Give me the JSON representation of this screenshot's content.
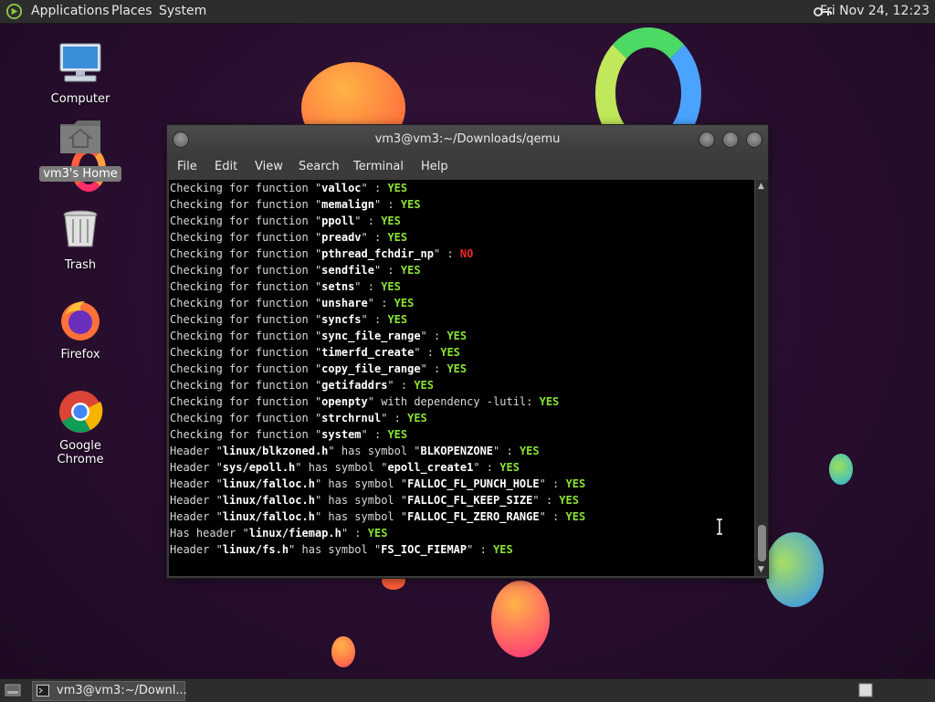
{
  "top_panel": {
    "menus": [
      "Applications",
      "Places",
      "System"
    ],
    "clock": "Fri Nov 24, 12:23"
  },
  "desktop_icons": [
    {
      "label": "Computer",
      "icon": "computer-icon"
    },
    {
      "label": "vm3's Home",
      "icon": "home-folder-icon",
      "selected": true
    },
    {
      "label": "Trash",
      "icon": "trash-icon"
    },
    {
      "label": "Firefox",
      "icon": "firefox-icon"
    },
    {
      "label": "Google Chrome",
      "icon": "chrome-icon"
    }
  ],
  "window": {
    "title": "vm3@vm3:~/Downloads/qemu",
    "menus": [
      "File",
      "Edit",
      "View",
      "Search",
      "Terminal",
      "Help"
    ]
  },
  "terminal": {
    "lines": [
      [
        [
          "Checking for function \"",
          "t"
        ],
        [
          "valloc",
          "b"
        ],
        [
          "\" : ",
          "t"
        ],
        [
          "YES",
          "yes"
        ]
      ],
      [
        [
          "Checking for function \"",
          "t"
        ],
        [
          "memalign",
          "b"
        ],
        [
          "\" : ",
          "t"
        ],
        [
          "YES",
          "yes"
        ]
      ],
      [
        [
          "Checking for function \"",
          "t"
        ],
        [
          "ppoll",
          "b"
        ],
        [
          "\" : ",
          "t"
        ],
        [
          "YES",
          "yes"
        ]
      ],
      [
        [
          "Checking for function \"",
          "t"
        ],
        [
          "preadv",
          "b"
        ],
        [
          "\" : ",
          "t"
        ],
        [
          "YES",
          "yes"
        ]
      ],
      [
        [
          "Checking for function \"",
          "t"
        ],
        [
          "pthread_fchdir_np",
          "b"
        ],
        [
          "\" : ",
          "t"
        ],
        [
          "NO",
          "no"
        ]
      ],
      [
        [
          "Checking for function \"",
          "t"
        ],
        [
          "sendfile",
          "b"
        ],
        [
          "\" : ",
          "t"
        ],
        [
          "YES",
          "yes"
        ]
      ],
      [
        [
          "Checking for function \"",
          "t"
        ],
        [
          "setns",
          "b"
        ],
        [
          "\" : ",
          "t"
        ],
        [
          "YES",
          "yes"
        ]
      ],
      [
        [
          "Checking for function \"",
          "t"
        ],
        [
          "unshare",
          "b"
        ],
        [
          "\" : ",
          "t"
        ],
        [
          "YES",
          "yes"
        ]
      ],
      [
        [
          "Checking for function \"",
          "t"
        ],
        [
          "syncfs",
          "b"
        ],
        [
          "\" : ",
          "t"
        ],
        [
          "YES",
          "yes"
        ]
      ],
      [
        [
          "Checking for function \"",
          "t"
        ],
        [
          "sync_file_range",
          "b"
        ],
        [
          "\" : ",
          "t"
        ],
        [
          "YES",
          "yes"
        ]
      ],
      [
        [
          "Checking for function \"",
          "t"
        ],
        [
          "timerfd_create",
          "b"
        ],
        [
          "\" : ",
          "t"
        ],
        [
          "YES",
          "yes"
        ]
      ],
      [
        [
          "Checking for function \"",
          "t"
        ],
        [
          "copy_file_range",
          "b"
        ],
        [
          "\" : ",
          "t"
        ],
        [
          "YES",
          "yes"
        ]
      ],
      [
        [
          "Checking for function \"",
          "t"
        ],
        [
          "getifaddrs",
          "b"
        ],
        [
          "\" : ",
          "t"
        ],
        [
          "YES",
          "yes"
        ]
      ],
      [
        [
          "Checking for function \"",
          "t"
        ],
        [
          "openpty",
          "b"
        ],
        [
          "\" with dependency -lutil: ",
          "t"
        ],
        [
          "YES",
          "yes"
        ]
      ],
      [
        [
          "Checking for function \"",
          "t"
        ],
        [
          "strchrnul",
          "b"
        ],
        [
          "\" : ",
          "t"
        ],
        [
          "YES",
          "yes"
        ]
      ],
      [
        [
          "Checking for function \"",
          "t"
        ],
        [
          "system",
          "b"
        ],
        [
          "\" : ",
          "t"
        ],
        [
          "YES",
          "yes"
        ]
      ],
      [
        [
          "Header \"",
          "t"
        ],
        [
          "linux/blkzoned.h",
          "b"
        ],
        [
          "\" has symbol \"",
          "t"
        ],
        [
          "BLKOPENZONE",
          "b"
        ],
        [
          "\" : ",
          "t"
        ],
        [
          "YES",
          "yes"
        ]
      ],
      [
        [
          "Header \"",
          "t"
        ],
        [
          "sys/epoll.h",
          "b"
        ],
        [
          "\" has symbol \"",
          "t"
        ],
        [
          "epoll_create1",
          "b"
        ],
        [
          "\" : ",
          "t"
        ],
        [
          "YES",
          "yes"
        ]
      ],
      [
        [
          "Header \"",
          "t"
        ],
        [
          "linux/falloc.h",
          "b"
        ],
        [
          "\" has symbol \"",
          "t"
        ],
        [
          "FALLOC_FL_PUNCH_HOLE",
          "b"
        ],
        [
          "\" : ",
          "t"
        ],
        [
          "YES",
          "yes"
        ]
      ],
      [
        [
          "Header \"",
          "t"
        ],
        [
          "linux/falloc.h",
          "b"
        ],
        [
          "\" has symbol \"",
          "t"
        ],
        [
          "FALLOC_FL_KEEP_SIZE",
          "b"
        ],
        [
          "\" : ",
          "t"
        ],
        [
          "YES",
          "yes"
        ]
      ],
      [
        [
          "Header \"",
          "t"
        ],
        [
          "linux/falloc.h",
          "b"
        ],
        [
          "\" has symbol \"",
          "t"
        ],
        [
          "FALLOC_FL_ZERO_RANGE",
          "b"
        ],
        [
          "\" : ",
          "t"
        ],
        [
          "YES",
          "yes"
        ]
      ],
      [
        [
          "Has header \"",
          "t"
        ],
        [
          "linux/fiemap.h",
          "b"
        ],
        [
          "\" : ",
          "t"
        ],
        [
          "YES",
          "yes"
        ]
      ],
      [
        [
          "Header \"",
          "t"
        ],
        [
          "linux/fs.h",
          "b"
        ],
        [
          "\" has symbol \"",
          "t"
        ],
        [
          "FS_IOC_FIEMAP",
          "b"
        ],
        [
          "\" : ",
          "t"
        ],
        [
          "YES",
          "yes"
        ]
      ]
    ]
  },
  "taskbar": {
    "task_label": "vm3@vm3:~/Downl..."
  },
  "colors": {
    "yes": "#8ae234",
    "no": "#ef2929",
    "panel": "#2d2d2d"
  }
}
